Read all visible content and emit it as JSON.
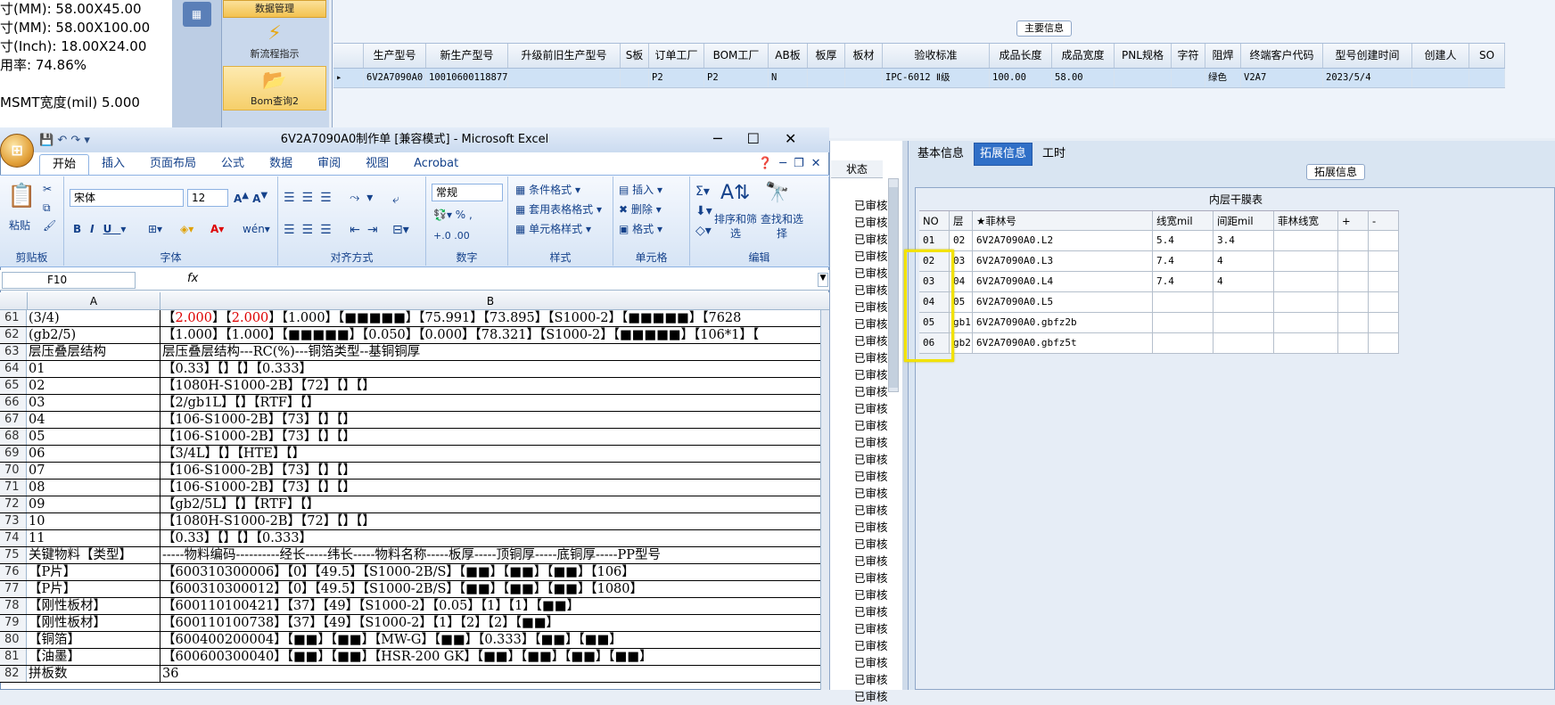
{
  "left_info": [
    "寸(MM): 58.00X45.00",
    "寸(MM): 58.00X100.00",
    "寸(Inch): 18.00X24.00",
    "用率: 74.86%",
    "",
    "MSMT宽度(mil) 5.000"
  ],
  "nav": {
    "data_mgmt": "数据管理",
    "new_flow": "新流程指示",
    "bom_query": "Bom查询2"
  },
  "main_info": {
    "legend": "主要信息",
    "columns": [
      "",
      "生产型号",
      "新生产型号",
      "升级前旧生产型号",
      "S板",
      "订单工厂",
      "BOM工厂",
      "AB板",
      "板厚",
      "板材",
      "验收标准",
      "成品长度",
      "成品宽度",
      "PNL规格",
      "字符",
      "阻焊",
      "终端客户代码",
      "型号创建时间",
      "创建人",
      "SO"
    ],
    "row": [
      "▸",
      "6V2A7090A0",
      "10010600118877",
      "",
      "",
      "P2",
      "P2",
      "N",
      "",
      "",
      "IPC-6012 Ⅱ级",
      "100.00",
      "58.00",
      "",
      "",
      "绿色",
      "V2A7",
      "2023/5/4",
      "",
      ""
    ]
  },
  "right_tabs": [
    "基本信息",
    "拓展信息",
    "工时"
  ],
  "ext_legend": "拓展信息",
  "inner_table": {
    "title": "内层干膜表",
    "columns": [
      "NO",
      "层",
      "★菲林号",
      "线宽mil",
      "间距mil",
      "菲林线宽",
      "+",
      "-"
    ],
    "rows": [
      [
        "01",
        "02",
        "6V2A7090A0.L2",
        "5.4",
        "3.4",
        "",
        "",
        ""
      ],
      [
        "02",
        "03",
        "6V2A7090A0.L3",
        "7.4",
        "4",
        "",
        "",
        ""
      ],
      [
        "03",
        "04",
        "6V2A7090A0.L4",
        "7.4",
        "4",
        "",
        "",
        ""
      ],
      [
        "04",
        "05",
        "6V2A7090A0.L5",
        "",
        "",
        "",
        "",
        ""
      ],
      [
        "05",
        "gb1",
        "6V2A7090A0.gbfz2b",
        "",
        "",
        "",
        "",
        ""
      ],
      [
        "06",
        "gb2",
        "6V2A7090A0.gbfz5t",
        "",
        "",
        "",
        "",
        ""
      ]
    ]
  },
  "status_col": {
    "header": "状态",
    "value": "已审核"
  },
  "excel": {
    "title": "6V2A7090A0制作单  [兼容模式] - Microsoft Excel",
    "tabs": [
      "开始",
      "插入",
      "页面布局",
      "公式",
      "数据",
      "审阅",
      "视图",
      "Acrobat"
    ],
    "groups": {
      "clipboard": "剪贴板",
      "font": "字体",
      "align": "对齐方式",
      "number": "数字",
      "styles": "样式",
      "cells": "单元格",
      "edit": "编辑"
    },
    "paste": "粘贴",
    "font_name": "宋体",
    "font_size": "12",
    "number_format": "常规",
    "styles_items": [
      "条件格式",
      "套用表格格式",
      "单元格样式"
    ],
    "cells_items": [
      "插入",
      "删除",
      "格式"
    ],
    "edit_items": [
      "排序和筛选",
      "查找和选择"
    ],
    "name_box": "F10",
    "fx": "fx",
    "col_a": "A",
    "col_b": "B",
    "rows": [
      {
        "n": "61",
        "a": "(3/4)",
        "b": "【2.000】【2.000】【1.000】【■■■■■】【75.991】【73.895】【S1000-2】【■■■■■】【7628"
      },
      {
        "n": "62",
        "a": "(gb2/5)",
        "b": "【1.000】【1.000】【■■■■■】【0.050】【0.000】【78.321】【S1000-2】【■■■■■】【106*1】【"
      },
      {
        "n": "63",
        "a": "层压叠层结构",
        "b": "层压叠层结构---RC(%)---铜箔类型--基铜铜厚"
      },
      {
        "n": "64",
        "a": "01",
        "b": "【0.33】【】【】【0.333】"
      },
      {
        "n": "65",
        "a": "02",
        "b": "【1080H-S1000-2B】【72】【】【】"
      },
      {
        "n": "66",
        "a": "03",
        "b": "【2/gb1L】【】【RTF】【】"
      },
      {
        "n": "67",
        "a": "04",
        "b": "【106-S1000-2B】【73】【】【】"
      },
      {
        "n": "68",
        "a": "05",
        "b": "【106-S1000-2B】【73】【】【】"
      },
      {
        "n": "69",
        "a": "06",
        "b": "【3/4L】【】【HTE】【】"
      },
      {
        "n": "70",
        "a": "07",
        "b": "【106-S1000-2B】【73】【】【】"
      },
      {
        "n": "71",
        "a": "08",
        "b": "【106-S1000-2B】【73】【】【】"
      },
      {
        "n": "72",
        "a": "09",
        "b": "【gb2/5L】【】【RTF】【】"
      },
      {
        "n": "73",
        "a": "10",
        "b": "【1080H-S1000-2B】【72】【】【】"
      },
      {
        "n": "74",
        "a": "11",
        "b": "【0.33】【】【】【0.333】"
      },
      {
        "n": "75",
        "a": "关键物料【类型】",
        "b": "-----物料编码----------经长-----纬长-----物料名称-----板厚-----顶铜厚-----底铜厚-----PP型号"
      },
      {
        "n": "76",
        "a": "【P片】",
        "b": "【600310300006】【0】【49.5】【S1000-2B/S】【■■】【■■】【■■】【106】"
      },
      {
        "n": "77",
        "a": "【P片】",
        "b": "【600310300012】【0】【49.5】【S1000-2B/S】【■■】【■■】【■■】【1080】"
      },
      {
        "n": "78",
        "a": "【刚性板材】",
        "b": "【600110100421】【37】【49】【S1000-2】【0.05】【1】【1】【■■】"
      },
      {
        "n": "79",
        "a": "【刚性板材】",
        "b": "【600110100738】【37】【49】【S1000-2】【1】【2】【2】【■■】"
      },
      {
        "n": "80",
        "a": "【铜箔】",
        "b": "【600400200004】【■■】【■■】【MW-G】【■■】【0.333】【■■】【■■】"
      },
      {
        "n": "81",
        "a": "【油墨】",
        "b": "【600600300040】【■■】【■■】【HSR-200 GK】【■■】【■■】【■■】【■■】"
      },
      {
        "n": "82",
        "a": "拼板数",
        "b": "36"
      }
    ]
  }
}
